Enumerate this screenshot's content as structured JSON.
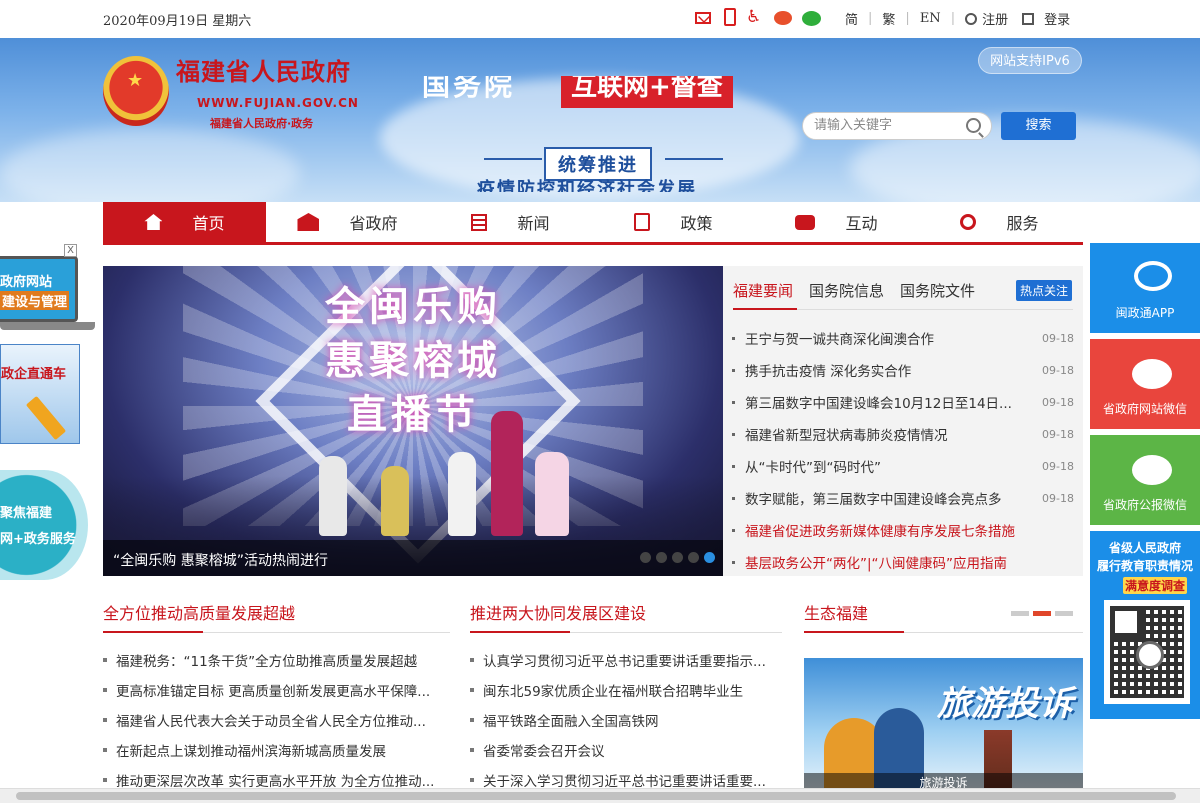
{
  "topbar": {
    "date": "2020年09月19日  星期六",
    "icons": [
      "mail-icon",
      "phone-icon",
      "accessibility-icon",
      "weibo-icon",
      "wechat-icon"
    ],
    "lang_simplified": "简",
    "lang_traditional": "繁",
    "lang_english": "EN",
    "register": "注册",
    "login": "登录"
  },
  "header": {
    "site_title": "福建省人民政府",
    "site_domain": "WWW.FUJIAN.GOV.CN",
    "site_subtitle": "福建省人民政府·政务",
    "promo_title_1": "国务院",
    "promo_title_2": "互联网+督查",
    "promo_badge": "统筹推进",
    "promo_title_3": "疫情防控和经济社会发展",
    "ipv6_label": "网站支持IPv6",
    "search_placeholder": "请输入关键字",
    "search_button": "搜索"
  },
  "nav": {
    "items": [
      {
        "label": "首页",
        "icon": "home-icon",
        "active": true
      },
      {
        "label": "省政府",
        "icon": "government-building-icon"
      },
      {
        "label": "新闻",
        "icon": "newspaper-icon"
      },
      {
        "label": "政策",
        "icon": "document-icon"
      },
      {
        "label": "互动",
        "icon": "chat-bubbles-icon"
      },
      {
        "label": "服务",
        "icon": "service-icon"
      }
    ]
  },
  "carousel": {
    "text_line_1": "全闽乐购",
    "text_line_2": "惠聚榕城",
    "text_line_3": "直播节",
    "caption": "“全闽乐购 惠聚榕城”活动热闹进行",
    "slide_count": 5,
    "active_slide": 5,
    "accent_color": "#2a8fe0"
  },
  "hotnews": {
    "tabs": [
      "福建要闻",
      "国务院信息",
      "国务院文件"
    ],
    "active_tab": "福建要闻",
    "hot_button": "热点关注",
    "items": [
      {
        "title": "王宁与贺一诚共商深化闽澳合作",
        "date": "09-18"
      },
      {
        "title": "携手抗击疫情 深化务实合作",
        "date": "09-18"
      },
      {
        "title": "第三届数字中国建设峰会10月12日至14日...",
        "date": "09-18"
      },
      {
        "title": "福建省新型冠状病毒肺炎疫情情况",
        "date": "09-18"
      },
      {
        "title": "从“卡时代”到“码时代”",
        "date": "09-18"
      },
      {
        "title": "数字赋能，第三届数字中国建设峰会亮点多",
        "date": "09-18"
      },
      {
        "title": "福建省促进政务新媒体健康有序发展七条措施",
        "date": ""
      },
      {
        "title": "基层政务公开“两化”|“八闽健康码”应用指南",
        "date": ""
      }
    ]
  },
  "left_float": {
    "close": "X",
    "card1_line1": "政府网站",
    "card1_line2": "建设与管理",
    "card2_label": "政企直通车",
    "card3_line1": "聚焦福建",
    "card3_line2": "网+政务服务"
  },
  "sections": [
    {
      "title": "全方位推动高质量发展超越",
      "items": [
        "福建税务：“11条干货”全方位助推高质量发展超越",
        "更高标准锚定目标 更高质量创新发展更高水平保障...",
        "福建省人民代表大会关于动员全省人民全方位推动...",
        "在新起点上谋划推动福州滨海新城高质量发展",
        "推动更深层次改革 实行更高水平开放 为全方位推动..."
      ]
    },
    {
      "title": "推进两大协同发展区建设",
      "items": [
        "认真学习贯彻习近平总书记重要讲话重要指示...",
        "闽东北59家优质企业在福州联合招聘毕业生",
        "福平铁路全面融入全国高铁网",
        "省委常委会召开会议",
        "关于深入学习贯彻习近平总书记重要讲话重要..."
      ]
    },
    {
      "title": "生态福建",
      "banner_title": "旅游投诉",
      "banner_caption": "旅游投诉",
      "pager_count": 3,
      "pager_active": 2
    }
  ],
  "right_float": {
    "app_label": "闽政通APP",
    "web_wechat_label": "省政府网站微信",
    "pub_wechat_label": "省政府公报微信",
    "survey_line1": "省级人民政府",
    "survey_line2": "履行教育职责情况",
    "survey_line3": "满意度调查"
  },
  "colors": {
    "brand_red": "#c8161d",
    "link_blue": "#1f6fd3"
  }
}
